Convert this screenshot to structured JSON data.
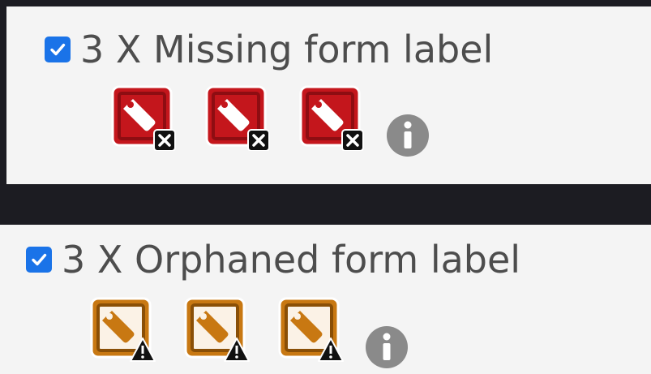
{
  "sections": [
    {
      "title": "3 X Missing form label",
      "checked": true,
      "icon_kind": "missing-label-error",
      "icon_color": "#c4161c",
      "icon_count": 3
    },
    {
      "title": "3 X Orphaned form label",
      "checked": true,
      "icon_kind": "orphaned-label-alert",
      "icon_color": "#c87812",
      "icon_count": 3
    }
  ],
  "colors": {
    "checkbox": "#1a73e8",
    "text": "#4d4d4d",
    "info": "#8a8a8a",
    "background": "#1c1c22",
    "card": "#f4f4f4"
  }
}
